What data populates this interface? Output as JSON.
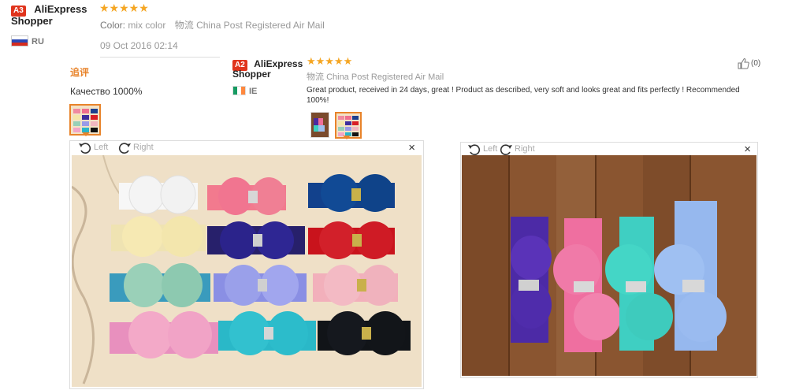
{
  "review1": {
    "badge": "A3",
    "shopper_line1": "AliExpress",
    "shopper_line2": "Shopper",
    "country": "RU",
    "stars": "★★★★★",
    "color_label": "Color:",
    "color_value": "mix color",
    "shipping_label": "物流",
    "shipping_value": "China Post Registered Air Mail",
    "date": "09 Oct 2016 02:14"
  },
  "followup": {
    "label": "追评",
    "text": "Качество 1000%"
  },
  "review2": {
    "badge": "A2",
    "shopper_line1": "AliExpress",
    "shopper_line2": "Shopper",
    "country": "IE",
    "stars": "★★★★★",
    "shipping_label": "物流",
    "shipping_value": "China Post Registered Air Mail",
    "text": "Great product, received in 24 days, great ! Product as described, very soft and looks great and fits perfectly ! Recommended 100%!",
    "likes": "(0)"
  },
  "viewer1": {
    "left_label": "Left",
    "right_label": "Right",
    "close": "×"
  },
  "viewer2": {
    "left_label": "Left",
    "right_label": "Right",
    "close": "×"
  },
  "colors": {
    "accent": "#e0341c",
    "stars": "#f5a623",
    "selected_border": "#e8832a"
  }
}
